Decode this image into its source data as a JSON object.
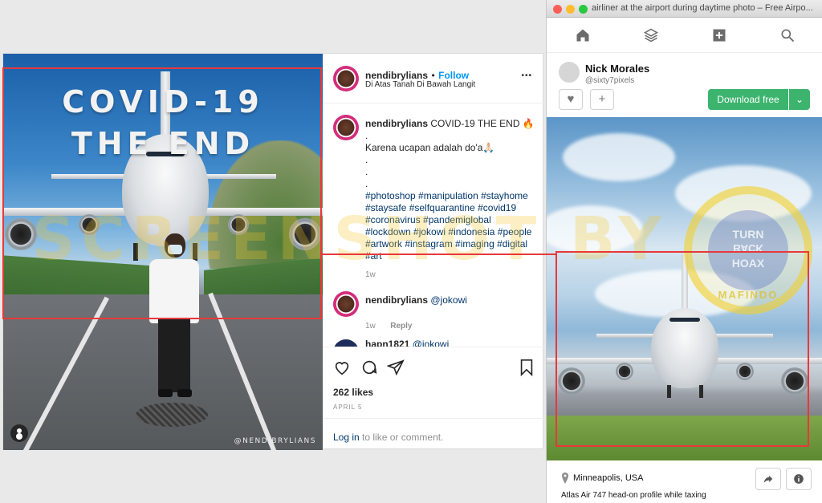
{
  "instagram": {
    "photo": {
      "headline_line1": "COVID-19",
      "headline_line2": "THE END",
      "watermark": "@NENDIBRYLIANS"
    },
    "header": {
      "username": "nendibrylians",
      "separator": "•",
      "follow_label": "Follow",
      "location": "Di Atas Tanah Di Bawah Langit",
      "more_label": "•••"
    },
    "caption": {
      "username": "nendibrylians",
      "text": "COVID-19 THE END 🔥",
      "line2": ".",
      "line3": "Karena ucapan adalah do'a🙏🏻",
      "dots": [
        ".",
        ".",
        "."
      ],
      "hashtags": "#photoshop #manipulation #stayhome #staysafe #selfquarantine #covid19 #coronavirus #pandemiglobal #lockdown #jokowi #indonesia #people #artwork #instagram #imaging #digital #art",
      "time": "1w"
    },
    "comments": [
      {
        "username": "nendibrylians",
        "text": "@jokowi",
        "time": "1w",
        "reply": "Reply"
      },
      {
        "username": "hapn1821",
        "text": "@jokowi"
      }
    ],
    "likes": "262 likes",
    "date": "APRIL 5",
    "login_link": "Log in",
    "login_rest": " to like or comment."
  },
  "browser": {
    "window_title": "airliner at the airport during daytime photo – Free Airpo...",
    "author": {
      "name": "Nick Morales",
      "handle": "@sixty7pixels"
    },
    "like_icon": "♥",
    "add_icon": "+",
    "download_label": "Download free",
    "download_caret": "⌄",
    "location": "Minneapolis, USA",
    "description": "Atlas Air 747 head-on profile while taxing"
  },
  "overlay": {
    "watermark_text": "SCREENSHOT BY",
    "seal_top": "TURN",
    "seal_mid": "BACK",
    "seal_bottom": "HOAX",
    "seal_ring": "MAFINDO"
  },
  "colors": {
    "annotation_red": "#e8383a",
    "instagram_blue": "#0095f6",
    "download_green": "#3cb46e"
  },
  "icons": [
    "home-icon",
    "collections-icon",
    "add-icon",
    "search-icon",
    "heart-icon",
    "comment-icon",
    "share-icon",
    "bookmark-icon",
    "user-icon",
    "location-pin-icon",
    "info-icon"
  ]
}
